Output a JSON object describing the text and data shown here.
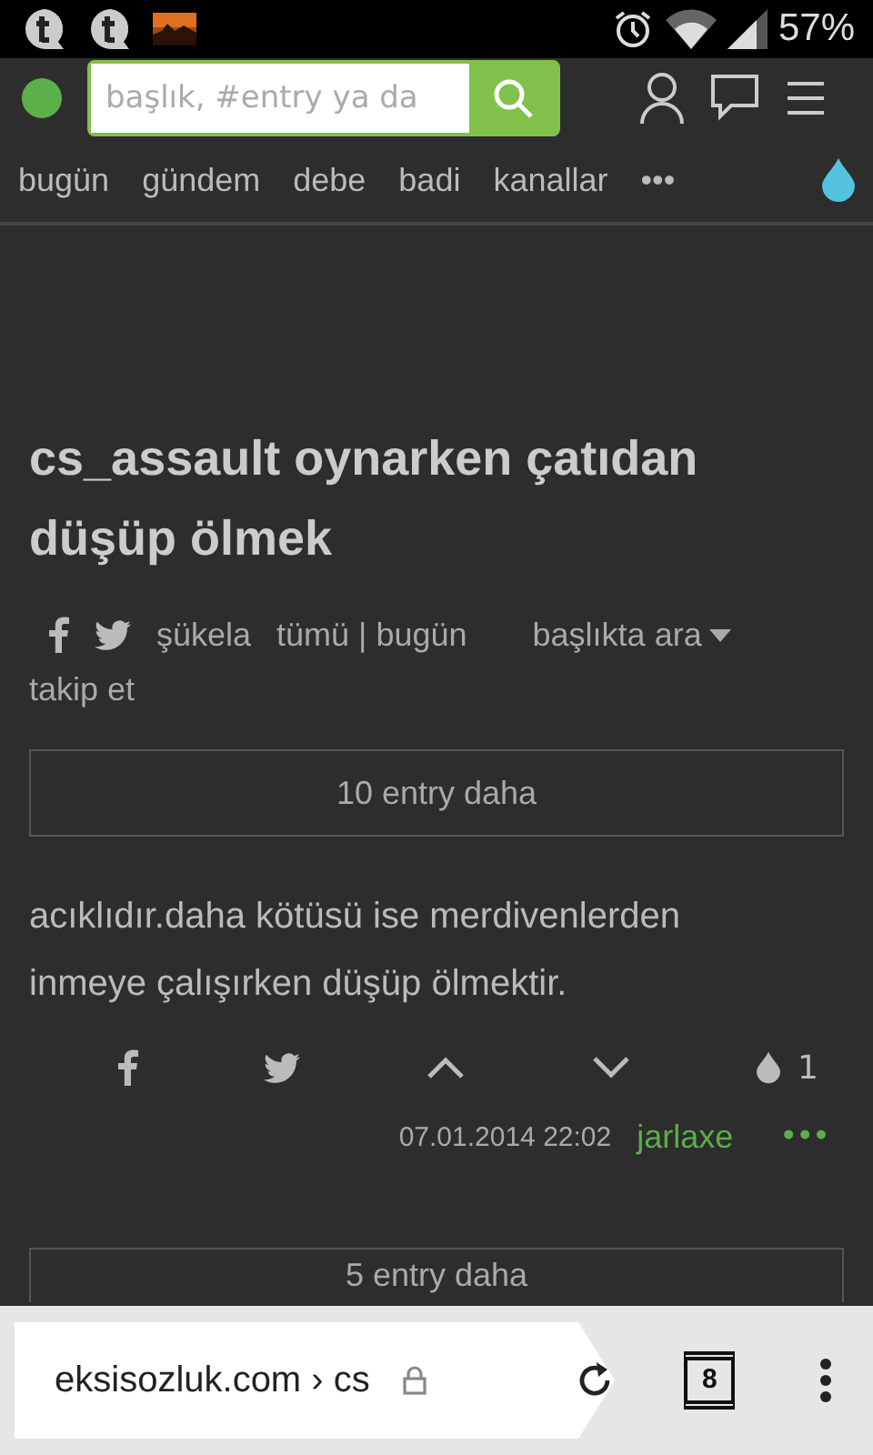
{
  "status_bar": {
    "battery": "57%"
  },
  "header": {
    "search": {
      "placeholder": "başlık, #entry ya da"
    }
  },
  "nav": {
    "items": [
      "bugün",
      "gündem",
      "debe",
      "badi",
      "kanallar",
      "•••"
    ]
  },
  "topic": {
    "title": "cs_assault oynarken çatıdan düşüp ölmek",
    "filters": [
      "şükela",
      "tümü | bugün"
    ],
    "search_menu": "başlıkta ara",
    "follow": "takip et"
  },
  "more_before": "10 entry daha",
  "entry": {
    "text": "acıklıdır.daha kötüsü ise merdivenlerden inmeye çalışırken düşüp ölmektir.",
    "favorites": "1",
    "date": "07.01.2014 22:02",
    "author": "jarlaxe",
    "menu": "•••"
  },
  "more_after": "5 entry daha",
  "browser": {
    "url": "eksisozluk.com › cs",
    "tabs": "8"
  }
}
